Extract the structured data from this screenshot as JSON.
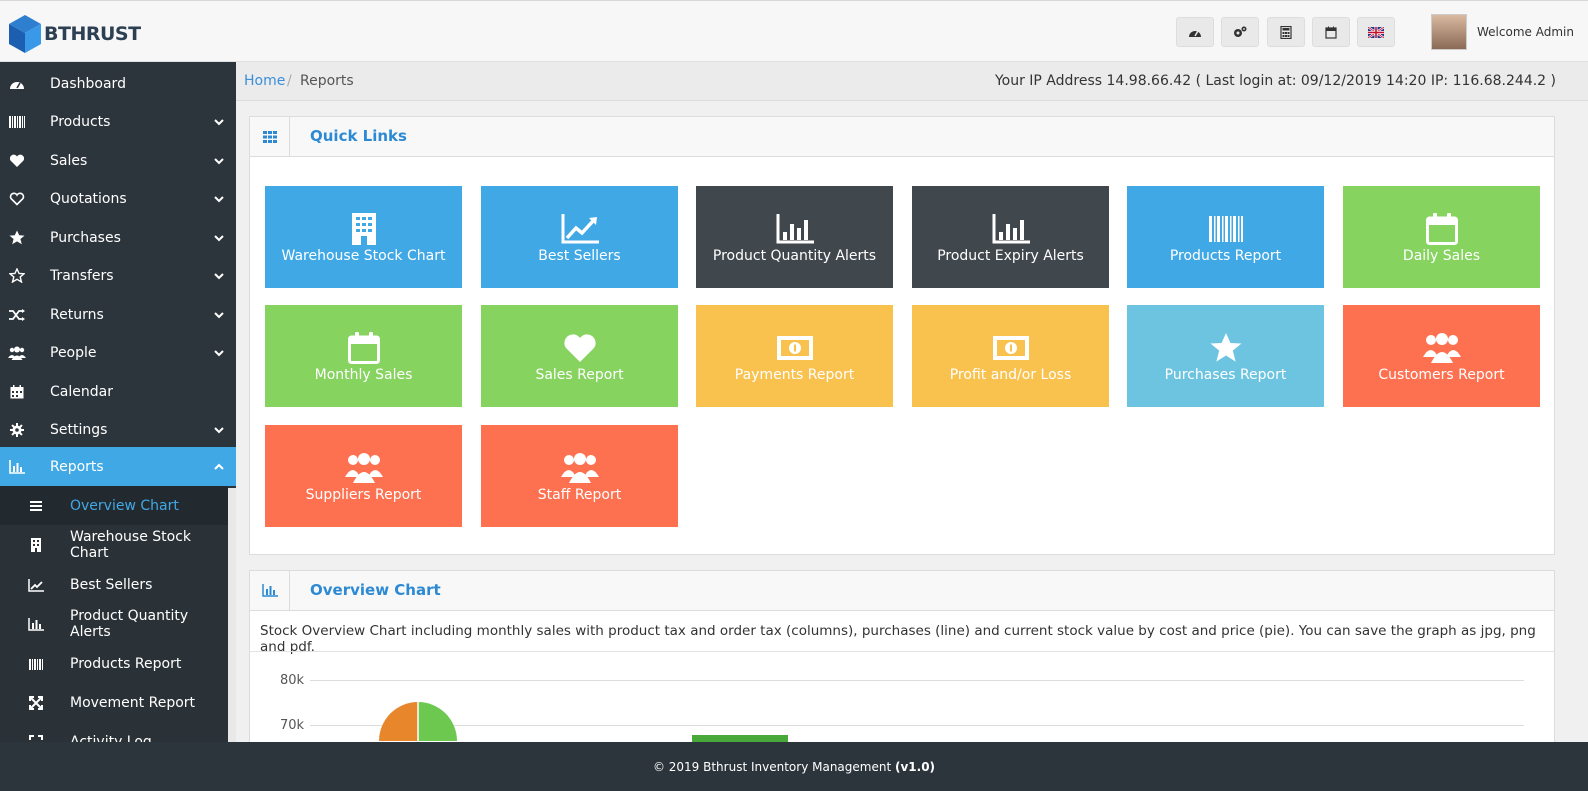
{
  "brand": {
    "name": "BTHRUST"
  },
  "header": {
    "buttons": [
      {
        "name": "dashboard-button",
        "icon": "dashboard-icon"
      },
      {
        "name": "settings-button",
        "icon": "gears-icon"
      },
      {
        "name": "calculator-button",
        "icon": "calculator-icon"
      },
      {
        "name": "calendar-button",
        "icon": "calendar-icon"
      },
      {
        "name": "language-button",
        "icon": "uk-flag-icon"
      }
    ],
    "welcome": "Welcome Admin"
  },
  "sidebar": {
    "items": [
      {
        "label": "Dashboard",
        "icon": "dashboard-icon"
      },
      {
        "label": "Products",
        "icon": "barcode-icon"
      },
      {
        "label": "Sales",
        "icon": "heart-icon"
      },
      {
        "label": "Quotations",
        "icon": "heart-outline-icon"
      },
      {
        "label": "Purchases",
        "icon": "star-icon"
      },
      {
        "label": "Transfers",
        "icon": "star-outline-icon"
      },
      {
        "label": "Returns",
        "icon": "random-icon"
      },
      {
        "label": "People",
        "icon": "users-icon"
      },
      {
        "label": "Calendar",
        "icon": "calendar-icon"
      },
      {
        "label": "Settings",
        "icon": "cog-icon"
      },
      {
        "label": "Reports",
        "icon": "bar-chart-icon"
      }
    ],
    "report_items": [
      {
        "label": "Overview Chart",
        "icon": "bars-icon"
      },
      {
        "label": "Warehouse Stock Chart",
        "icon": "building-icon"
      },
      {
        "label": "Best Sellers",
        "icon": "line-chart-icon"
      },
      {
        "label": "Product Quantity Alerts",
        "icon": "bar-chart-icon"
      },
      {
        "label": "Products Report",
        "icon": "barcode-icon"
      },
      {
        "label": "Movement Report",
        "icon": "arrows-icon"
      },
      {
        "label": "Activity Log",
        "icon": "expand-icon"
      }
    ]
  },
  "breadcrumb": {
    "home": "Home",
    "separator": "/",
    "current": "Reports"
  },
  "ip_info": "Your IP Address 14.98.66.42 ( Last login at: 09/12/2019 14:20 IP: 116.68.244.2 )",
  "quick_links": {
    "title": "Quick Links",
    "tiles": [
      {
        "label": "Warehouse Stock Chart",
        "icon": "building-icon",
        "color": "#41a8e6"
      },
      {
        "label": "Best Sellers",
        "icon": "line-chart-icon",
        "color": "#41a8e6"
      },
      {
        "label": "Product Quantity Alerts",
        "icon": "bar-chart-icon",
        "color": "#40474d"
      },
      {
        "label": "Product Expiry Alerts",
        "icon": "bar-chart-icon",
        "color": "#40474d"
      },
      {
        "label": "Products Report",
        "icon": "barcode-icon",
        "color": "#41a8e6"
      },
      {
        "label": "Daily Sales",
        "icon": "calendar-icon",
        "color": "#86d35f"
      },
      {
        "label": "Monthly Sales",
        "icon": "calendar-icon",
        "color": "#86d35f"
      },
      {
        "label": "Sales Report",
        "icon": "heart-icon",
        "color": "#86d35f"
      },
      {
        "label": "Payments Report",
        "icon": "money-icon",
        "color": "#f9c24f"
      },
      {
        "label": "Profit and/or Loss",
        "icon": "money-icon",
        "color": "#f9c24f"
      },
      {
        "label": "Purchases Report",
        "icon": "star-icon",
        "color": "#6cc4e0"
      },
      {
        "label": "Customers Report",
        "icon": "users-icon",
        "color": "#fd7150"
      },
      {
        "label": "Suppliers Report",
        "icon": "users-icon",
        "color": "#fd7150"
      },
      {
        "label": "Staff Report",
        "icon": "users-icon",
        "color": "#fd7150"
      }
    ]
  },
  "overview": {
    "title": "Overview Chart",
    "description": "Stock Overview Chart including monthly sales with product tax and order tax (columns), purchases (line) and current stock value by cost and price (pie). You can save the graph as jpg, png and pdf."
  },
  "chart_data": {
    "type": "bar",
    "y_ticks": [
      "80k",
      "70k"
    ]
  },
  "footer": {
    "text": "© 2019 Bthrust Inventory Management",
    "version": "(v1.0)"
  }
}
